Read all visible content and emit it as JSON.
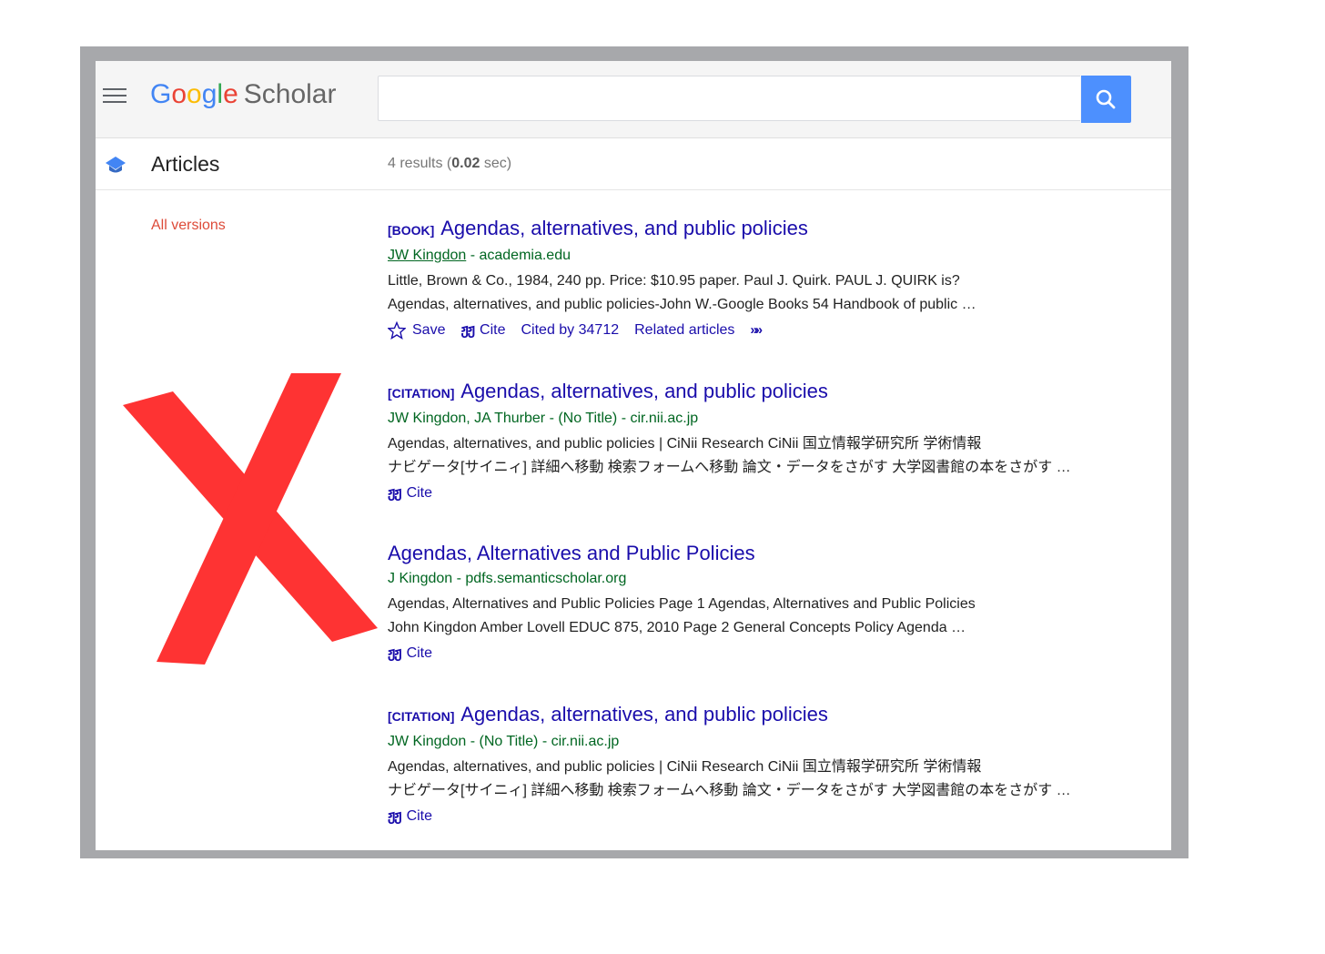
{
  "header": {
    "logo_letters": [
      "G",
      "o",
      "o",
      "g",
      "l",
      "e"
    ],
    "logo_suffix": "Scholar",
    "search_value": ""
  },
  "subbar": {
    "label": "Articles",
    "count_prefix": "4 results (",
    "count_time": "0.02",
    "count_suffix": " sec)"
  },
  "sidebar": {
    "all_versions": "All versions"
  },
  "results": [
    {
      "tag": "[BOOK]",
      "title": "Agendas, alternatives, and public policies",
      "author_link": "JW Kingdon",
      "source": " - academia.edu",
      "snippet1": "Little, Brown & Co., 1984, 240 pp. Price: $10.95 paper. Paul J. Quirk. PAUL J. QUIRK is?",
      "snippet2": "Agendas, alternatives, and public policies-John W.-Google Books 54 Handbook of public …",
      "save": "Save",
      "cite": "Cite",
      "cited_by": "Cited by 34712",
      "related": "Related articles"
    },
    {
      "tag": "[CITATION]",
      "title": "Agendas, alternatives, and public policies",
      "source": "JW Kingdon, JA Thurber - (No Title) - cir.nii.ac.jp",
      "snippet1": "Agendas, alternatives, and public policies | CiNii Research CiNii 国立情報学研究所 学術情報",
      "snippet2": "ナビゲータ[サイニィ] 詳細へ移動 検索フォームへ移動 論文・データをさがす 大学図書館の本をさがす …",
      "cite": "Cite"
    },
    {
      "title": "Agendas, Alternatives and Public Policies",
      "source": "J Kingdon - pdfs.semanticscholar.org",
      "snippet1": "Agendas, Alternatives and Public Policies Page 1 Agendas, Alternatives and Public Policies",
      "snippet2": "John Kingdon Amber Lovell EDUC 875, 2010 Page 2 General Concepts Policy Agenda …",
      "cite": "Cite"
    },
    {
      "tag": "[CITATION]",
      "title": "Agendas, alternatives, and public policies",
      "source": "JW Kingdon - (No Title) - cir.nii.ac.jp",
      "snippet1": "Agendas, alternatives, and public policies | CiNii Research CiNii 国立情報学研究所 学術情報",
      "snippet2": "ナビゲータ[サイニィ] 詳細へ移動 検索フォームへ移動 論文・データをさがす 大学図書館の本をさがす …",
      "cite": "Cite"
    }
  ],
  "icons": {
    "menu": "menu-icon",
    "search": "search-icon",
    "cap": "graduation-cap-icon",
    "star": "star-icon",
    "quote": "quote-icon",
    "more": "double-chevron-icon",
    "overlay": "red-x-mark"
  },
  "colors": {
    "link": "#1a0dab",
    "green": "#006621",
    "red": "#dd4b39",
    "search_btn": "#4d90fe",
    "x_mark": "#fe3333",
    "frame": "#a7a8ab"
  }
}
